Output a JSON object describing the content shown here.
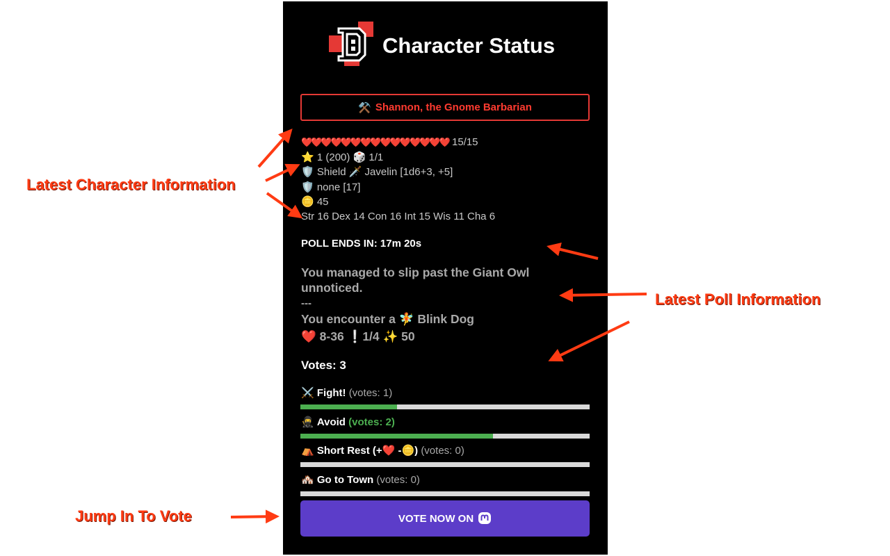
{
  "app": {
    "title": "Character Status"
  },
  "character": {
    "emoji": "⚒️",
    "name": "Shannon, the Gnome Barbarian",
    "hearts": "❤️❤️❤️❤️❤️❤️❤️❤️❤️❤️❤️❤️❤️❤️❤️",
    "hp": "15/15",
    "level_line": "⭐ 1 (200) 🎲 1/1",
    "weapon_line": "🛡️ Shield 🗡️ Javelin [1d6+3, +5]",
    "armor_line": "🛡️ none [17]",
    "coins_line": "🪙 45",
    "attributes": "Str 16 Dex 14 Con 16 Int 15 Wis 11 Cha 6"
  },
  "poll": {
    "ends_in": "POLL ENDS IN: 17m 20s",
    "story_line1": "You managed to slip past the Giant Owl",
    "story_line2": "unnoticed.",
    "divider": "---",
    "encounter": "You encounter a 🧚 Blink Dog",
    "monster_stats": "❤️ 8-36 ❕1/4 ✨ 50",
    "votes_total": "Votes: 3",
    "options": [
      {
        "emoji": "⚔️",
        "label": "Fight!",
        "votes": "(votes: 1)",
        "share": 0.333
      },
      {
        "emoji": "🥷",
        "label": "Avoid",
        "votes": "(votes: 2)",
        "share": 0.667
      },
      {
        "emoji": "⛺",
        "label": "Short Rest (+❤️ -🪙)",
        "votes": "(votes: 0)",
        "share": 0
      },
      {
        "emoji": "🏘️",
        "label": "Go to Town",
        "votes": "(votes: 0)",
        "share": 0
      }
    ]
  },
  "vote_button": {
    "label": "VOTE NOW ON"
  },
  "annotations": {
    "character_info": "Latest Character Information",
    "poll_info": "Latest Poll Information",
    "jump_in": "Jump In To Vote"
  },
  "colors": {
    "accent_red": "#ff3b30",
    "vote_green": "#4caf50",
    "button_purple": "#5c3dc9",
    "annotation_red": "#ff3b13"
  },
  "icons": {
    "logo": "dungeon-logo-icon",
    "mastodon": "mastodon-icon"
  }
}
